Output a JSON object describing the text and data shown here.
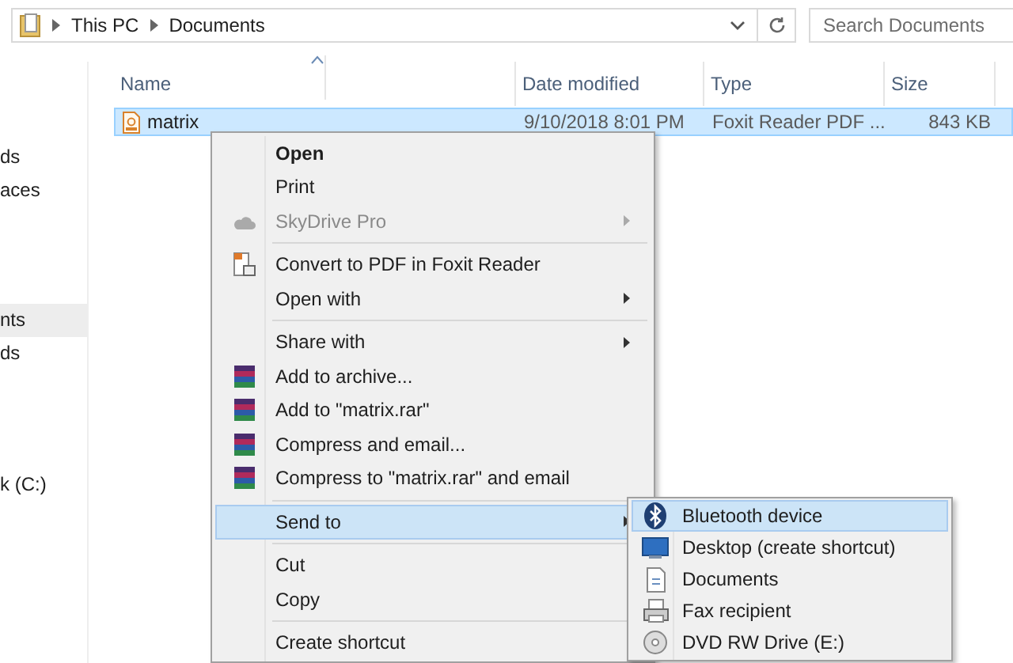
{
  "address_bar": {
    "path": [
      "This PC",
      "Documents"
    ]
  },
  "search": {
    "placeholder": "Search Documents"
  },
  "sidebar": {
    "items": [
      {
        "label": "ds",
        "selected": false
      },
      {
        "label": "aces",
        "selected": false
      },
      {
        "label": "nts",
        "selected": true
      },
      {
        "label": "ds",
        "selected": false
      },
      {
        "label": "k (C:)",
        "selected": false
      }
    ]
  },
  "table": {
    "columns": [
      "Name",
      "Date modified",
      "Type",
      "Size"
    ],
    "rows": [
      {
        "cells": [
          "matrix",
          "9/10/2018 8:01 PM",
          "Foxit Reader PDF ...",
          "843 KB"
        ],
        "selected": true
      }
    ]
  },
  "context_menu": {
    "groups": [
      [
        {
          "label": "Open",
          "kind": "plain",
          "bold": true,
          "disabled": false,
          "submenu": false,
          "selected": false
        },
        {
          "label": "Print",
          "kind": "plain",
          "bold": false,
          "disabled": false,
          "submenu": false,
          "selected": false
        },
        {
          "label": "SkyDrive Pro",
          "kind": "cloud",
          "bold": false,
          "disabled": true,
          "submenu": true,
          "selected": false
        }
      ],
      [
        {
          "label": "Convert to PDF in Foxit Reader",
          "kind": "foxit",
          "bold": false,
          "disabled": false,
          "submenu": false,
          "selected": false
        },
        {
          "label": "Open with",
          "kind": "plain",
          "bold": false,
          "disabled": false,
          "submenu": true,
          "selected": false
        }
      ],
      [
        {
          "label": "Share with",
          "kind": "plain",
          "bold": false,
          "disabled": false,
          "submenu": true,
          "selected": false
        },
        {
          "label": "Add to archive...",
          "kind": "rar",
          "bold": false,
          "disabled": false,
          "submenu": false,
          "selected": false
        },
        {
          "label": "Add to \"matrix.rar\"",
          "kind": "rar",
          "bold": false,
          "disabled": false,
          "submenu": false,
          "selected": false
        },
        {
          "label": "Compress and email...",
          "kind": "rar",
          "bold": false,
          "disabled": false,
          "submenu": false,
          "selected": false
        },
        {
          "label": "Compress to \"matrix.rar\" and email",
          "kind": "rar",
          "bold": false,
          "disabled": false,
          "submenu": false,
          "selected": false
        }
      ],
      [
        {
          "label": "Send to",
          "kind": "plain",
          "bold": false,
          "disabled": false,
          "submenu": true,
          "selected": true
        }
      ],
      [
        {
          "label": "Cut",
          "kind": "plain",
          "bold": false,
          "disabled": false,
          "submenu": false,
          "selected": false
        },
        {
          "label": "Copy",
          "kind": "plain",
          "bold": false,
          "disabled": false,
          "submenu": false,
          "selected": false
        }
      ],
      [
        {
          "label": "Create shortcut",
          "kind": "plain",
          "bold": false,
          "disabled": false,
          "submenu": false,
          "selected": false
        }
      ]
    ]
  },
  "send_to_menu": {
    "items": [
      {
        "label": "Bluetooth device",
        "kind": "bluetooth",
        "selected": true
      },
      {
        "label": "Desktop (create shortcut)",
        "kind": "desktop",
        "selected": false
      },
      {
        "label": "Documents",
        "kind": "document",
        "selected": false
      },
      {
        "label": "Fax recipient",
        "kind": "fax",
        "selected": false
      },
      {
        "label": "DVD RW Drive (E:)",
        "kind": "disc",
        "selected": false
      }
    ]
  }
}
